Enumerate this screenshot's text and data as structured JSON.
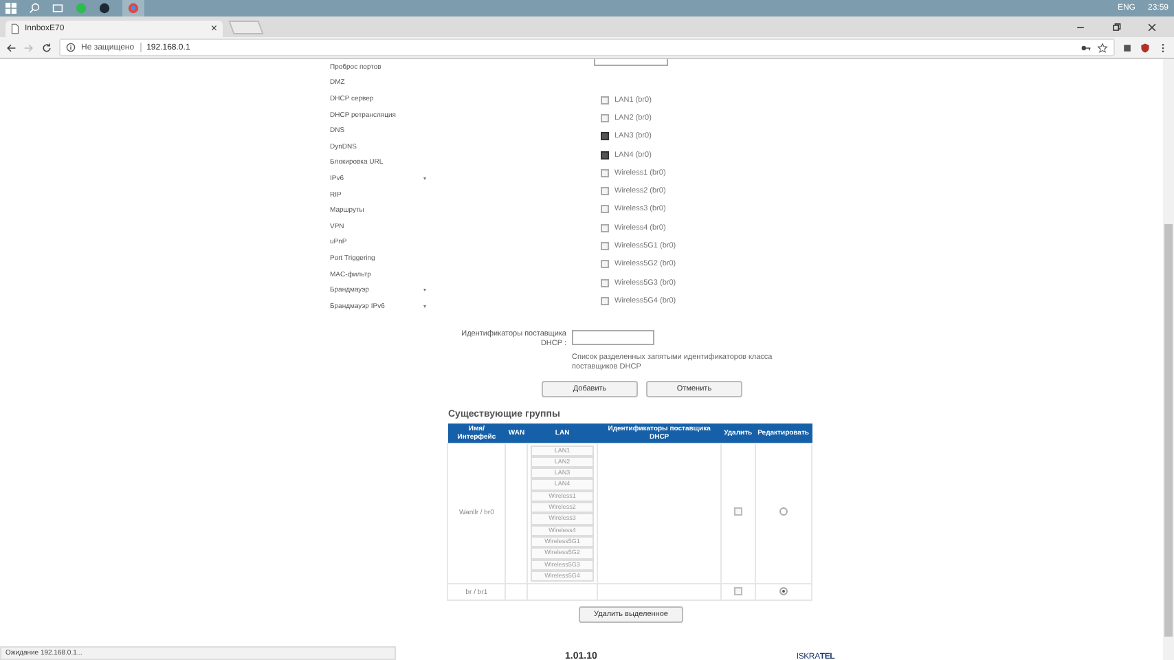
{
  "taskbar": {
    "language": "ENG",
    "time": "23:59"
  },
  "browser": {
    "tab": {
      "title": "InnboxE70",
      "close": "×"
    },
    "security": "Не защищено",
    "url": "192.168.0.1"
  },
  "sidebar": {
    "items": [
      {
        "label": "Проброс портов",
        "expandable": false
      },
      {
        "label": "DMZ",
        "expandable": false
      },
      {
        "label": "DHCP сервер",
        "expandable": false
      },
      {
        "label": "DHCP ретрансляция",
        "expandable": false
      },
      {
        "label": "DNS",
        "expandable": false
      },
      {
        "label": "DynDNS",
        "expandable": false
      },
      {
        "label": "Блокировка URL",
        "expandable": false
      },
      {
        "label": "IPv6",
        "expandable": true
      },
      {
        "label": "RIP",
        "expandable": false
      },
      {
        "label": "Маршруты",
        "expandable": false
      },
      {
        "label": "VPN",
        "expandable": false
      },
      {
        "label": "uPnP",
        "expandable": false
      },
      {
        "label": "Port Triggering",
        "expandable": false
      },
      {
        "label": "MAC-фильтр",
        "expandable": false
      },
      {
        "label": "Брандмауэр",
        "expandable": true
      },
      {
        "label": "Брандмауэр IPv6",
        "expandable": true
      }
    ]
  },
  "interfaces": [
    {
      "label": "LAN1 (br0)",
      "checked": false
    },
    {
      "label": "LAN2 (br0)",
      "checked": false
    },
    {
      "label": "LAN3 (br0)",
      "checked": true
    },
    {
      "label": "LAN4 (br0)",
      "checked": true
    },
    {
      "label": "Wireless1 (br0)",
      "checked": false
    },
    {
      "label": "Wireless2 (br0)",
      "checked": false
    },
    {
      "label": "Wireless3 (br0)",
      "checked": false
    },
    {
      "label": "Wireless4 (br0)",
      "checked": false
    },
    {
      "label": "Wireless5G1 (br0)",
      "checked": false
    },
    {
      "label": "Wireless5G2 (br0)",
      "checked": false
    },
    {
      "label": "Wireless5G3 (br0)",
      "checked": false
    },
    {
      "label": "Wireless5G4 (br0)",
      "checked": false
    }
  ],
  "dhcp_vendor": {
    "label": "Идентификаторы поставщика DHCP :",
    "hint": "Список разделенных запятыми идентификаторов класса поставщиков DHCP"
  },
  "buttons": [
    "Добавить",
    "Отменить"
  ],
  "groups": {
    "title": "Существующие группы",
    "columns": [
      "Имя/Интерфейс",
      "WAN",
      "LAN",
      "Идентификаторы поставщика DHCP",
      "Удалить",
      "Редактировать"
    ],
    "rows": [
      {
        "name": "Wanllr / br0",
        "lan": [
          "LAN1",
          "LAN2",
          "LAN3",
          "LAN4",
          "Wireless1",
          "Wireless2",
          "Wireless3",
          "Wireless4",
          "Wireless5G1",
          "Wireless5G2",
          "Wireless5G3",
          "Wireless5G4"
        ],
        "checked": false,
        "selected": false
      },
      {
        "name": "br / br1",
        "lan": [],
        "checked": false,
        "selected": true
      }
    ]
  },
  "delete_button": "Удалить выделенное",
  "footer": {
    "version": "1.01.10",
    "logo": "ISKRA**TEL**"
  },
  "status": "Ожидание 192.168.0.1..."
}
